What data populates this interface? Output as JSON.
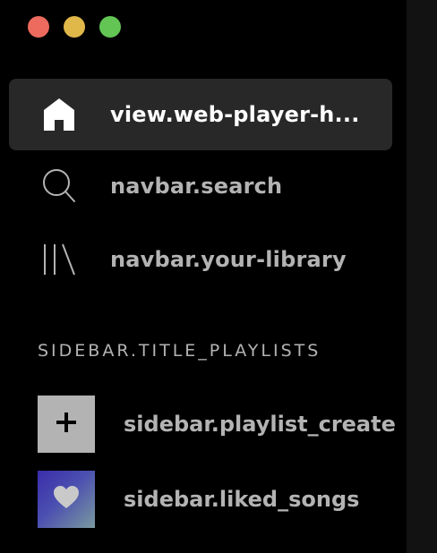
{
  "window": {
    "controls": [
      "close",
      "minimize",
      "maximize"
    ],
    "colors": {
      "close": "#ed6a5e",
      "minimize": "#e0b749",
      "maximize": "#62c554"
    }
  },
  "nav": {
    "items": [
      {
        "id": "home",
        "label": "view.web-player-h...",
        "icon": "home-icon",
        "active": true
      },
      {
        "id": "search",
        "label": "navbar.search",
        "icon": "search-icon",
        "active": false
      },
      {
        "id": "library",
        "label": "navbar.your-library",
        "icon": "library-icon",
        "active": false
      }
    ]
  },
  "playlists": {
    "title": "SIDEBAR.TITLE_PLAYLISTS",
    "create_label": "sidebar.playlist_create",
    "liked_label": "sidebar.liked_songs"
  },
  "theme": {
    "background": "#000000",
    "active_bg": "#282828",
    "text_muted": "#b3b3b3",
    "text_active": "#ffffff"
  }
}
